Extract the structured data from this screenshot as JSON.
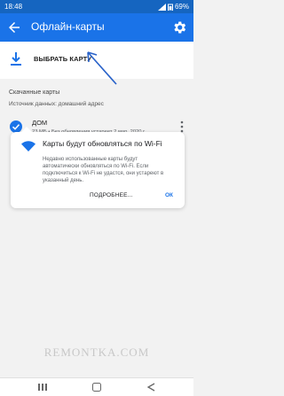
{
  "status_bar": {
    "time": "18:48",
    "battery": "69%"
  },
  "app_bar": {
    "title": "Офлайн-карты"
  },
  "select_map": {
    "label": "ВЫБРАТЬ КАРТУ"
  },
  "downloaded": {
    "section_title": "Скачанные карты",
    "hint": "Источник данных: домашний адрес",
    "items": [
      {
        "name": "ДОМ",
        "meta": "23 МБ • Без обновления устареет 2 мар. 2020 г."
      }
    ]
  },
  "wifi_card": {
    "title": "Карты будут обновляться по Wi-Fi",
    "text": "Недавно использованные карты будут автоматически обновляться по Wi-Fi. Если подключиться к Wi-Fi не удастся, они устареют в указанный день.",
    "more_label": "ПОДРОБНЕЕ...",
    "ok_label": "ОК"
  },
  "watermark": "REMONTKA.COM",
  "colors": {
    "accent": "#1a73e8",
    "status_bar": "#1565c0"
  }
}
